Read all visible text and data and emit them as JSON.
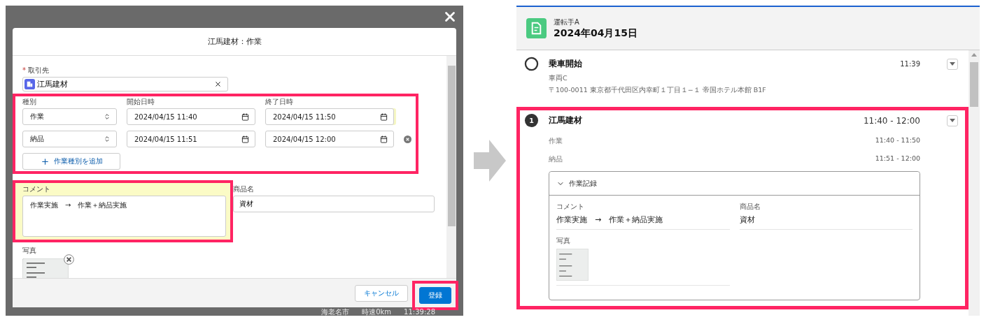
{
  "left_screen": {
    "modal": {
      "title": "江馬建材：作業",
      "account": {
        "label": "取引先",
        "required_mark": "*",
        "value": "江馬建材"
      },
      "work_types": {
        "highlighted": true,
        "columns": [
          "種別",
          "開始日時",
          "終了日時"
        ],
        "rows": [
          {
            "type": "作業",
            "start": "2024/04/15 11:40",
            "end": "2024/04/15 11:50",
            "end_edited": true,
            "removable": false
          },
          {
            "type": "納品",
            "start": "2024/04/15 11:51",
            "end": "2024/04/15 12:00",
            "end_edited": false,
            "removable": true
          }
        ]
      },
      "add_button": "作業種別を追加",
      "comment": {
        "label": "コメント",
        "value": "作業実施　→　作業＋納品実施",
        "edited": true,
        "highlighted": true
      },
      "product": {
        "label": "商品名",
        "value": "資材"
      },
      "photo": {
        "label": "写真",
        "kind": "picture"
      },
      "buttons": [
        {
          "label": "キャンセル",
          "kind": "neutral",
          "highlighted": false
        },
        {
          "label": "登録",
          "kind": "brand",
          "highlighted": true
        }
      ]
    },
    "map_labels": [
      "海老名市",
      "時速0km",
      "11:39:28"
    ]
  },
  "right_screen": {
    "header": {
      "subtitle": "運転手A",
      "title": "2024年04月15日"
    },
    "timeline": [
      {
        "kind": "start",
        "title": "乗車開始",
        "time": "11:39",
        "highlighted": false,
        "lines": [
          "車両C",
          "〒100-0011 東京都千代田区内幸町１丁目１−１ 帝国ホテル本館 B1F"
        ]
      },
      {
        "kind": "stop",
        "number": "1",
        "title": "江馬建材",
        "time": "11:40 - 12:00",
        "highlighted": true,
        "tasks": [
          {
            "name": "作業",
            "time": "11:40 - 11:50"
          },
          {
            "name": "納品",
            "time": "11:51 - 12:00"
          }
        ],
        "record": {
          "title": "作業記録",
          "expanded": true,
          "fields": [
            {
              "label": "コメント",
              "value": "作業実施　→　作業＋納品実施"
            },
            {
              "label": "商品名",
              "value": "資材"
            }
          ],
          "photo_label": "写真"
        }
      }
    ]
  }
}
